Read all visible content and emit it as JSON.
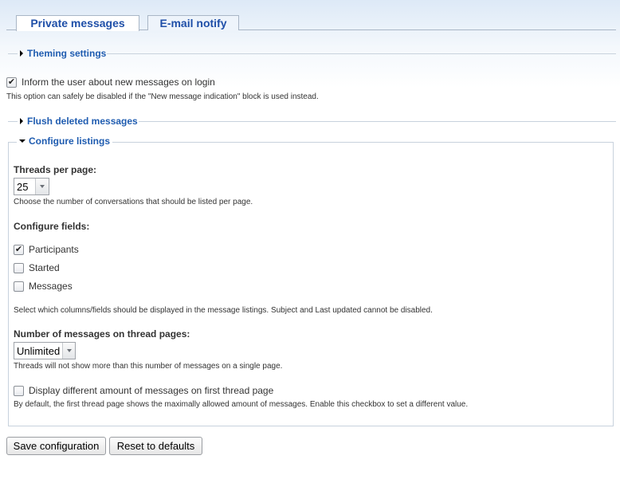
{
  "tabs": [
    {
      "label": "Private messages",
      "active": true
    },
    {
      "label": "E-mail notify",
      "active": false
    }
  ],
  "theming": {
    "legend": "Theming settings",
    "collapsed": true
  },
  "inform": {
    "label": "Inform the user about new messages on login",
    "checked": true,
    "description": "This option can safely be disabled if the \"New message indication\" block is used instead."
  },
  "flush": {
    "legend": "Flush deleted messages",
    "collapsed": true
  },
  "listings": {
    "legend": "Configure listings",
    "collapsed": false,
    "threads_label": "Threads per page:",
    "threads_value": "25",
    "threads_desc": "Choose the number of conversations that should be listed per page.",
    "fields_label": "Configure fields:",
    "fields": [
      {
        "label": "Participants",
        "checked": true
      },
      {
        "label": "Started",
        "checked": false
      },
      {
        "label": "Messages",
        "checked": false
      }
    ],
    "fields_desc": "Select which columns/fields should be displayed in the message listings. Subject and Last updated cannot be disabled.",
    "msgs_label": "Number of messages on thread pages:",
    "msgs_value": "Unlimited",
    "msgs_desc": "Threads will not show more than this number of messages on a single page.",
    "first_label": "Display different amount of messages on first thread page",
    "first_checked": false,
    "first_desc": "By default, the first thread page shows the maximally allowed amount of messages. Enable this checkbox to set a different value."
  },
  "buttons": {
    "save": "Save configuration",
    "reset": "Reset to defaults"
  }
}
